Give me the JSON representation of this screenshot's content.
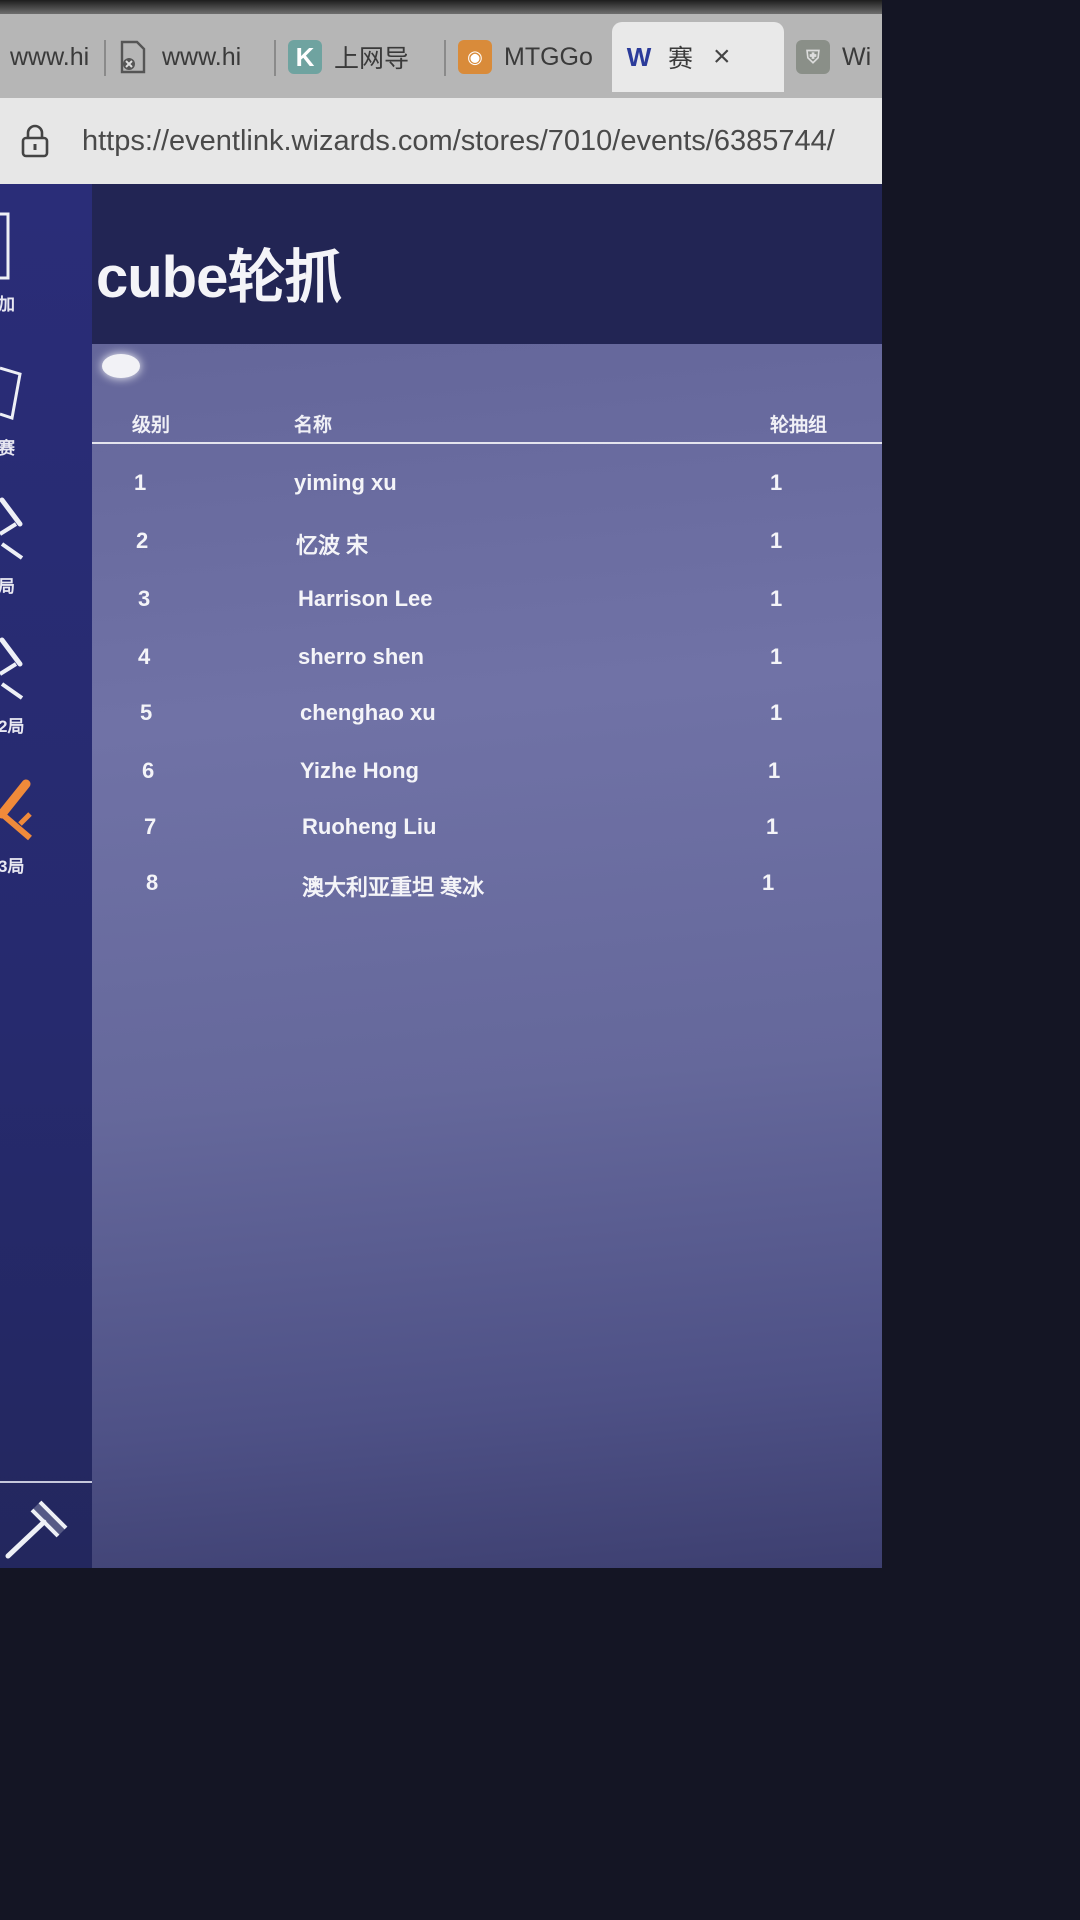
{
  "browser": {
    "tabs": [
      {
        "label": "www.hi",
        "icon": "globe-icon"
      },
      {
        "label": "www.hi",
        "icon": "broken-page-icon"
      },
      {
        "label": "上网导",
        "icon": "k-logo-icon"
      },
      {
        "label": "MTGGo",
        "icon": "mtggo-logo-icon"
      },
      {
        "label": "赛",
        "icon": "wizards-w-icon",
        "close": "×"
      },
      {
        "label": "Wi",
        "icon": "shield-logo-icon"
      }
    ],
    "url": "https://eventlink.wizards.com/stores/7010/events/6385744/"
  },
  "sidebar": {
    "items": [
      {
        "label": "加",
        "icon": "add-player-icon"
      },
      {
        "label": "赛",
        "icon": "cards-icon"
      },
      {
        "label": "局",
        "icon": "swords-icon"
      },
      {
        "label": "2局",
        "icon": "swords-icon"
      },
      {
        "label": "3局",
        "icon": "swords-active-icon"
      }
    ],
    "bottom_icon": "gavel-icon"
  },
  "event": {
    "title": "cube轮抓"
  },
  "table": {
    "headers": {
      "rank": "级别",
      "name": "名称",
      "pod": "轮抽组"
    },
    "rows": [
      {
        "rank": "1",
        "name": "yiming xu",
        "pod": "1"
      },
      {
        "rank": "2",
        "name": "忆波 宋",
        "pod": "1"
      },
      {
        "rank": "3",
        "name": "Harrison Lee",
        "pod": "1"
      },
      {
        "rank": "4",
        "name": "sherro shen",
        "pod": "1"
      },
      {
        "rank": "5",
        "name": "chenghao xu",
        "pod": "1"
      },
      {
        "rank": "6",
        "name": "Yizhe Hong",
        "pod": "1"
      },
      {
        "rank": "7",
        "name": "Ruoheng Liu",
        "pod": "1"
      },
      {
        "rank": "8",
        "name": "澳大利亚重坦 寒冰",
        "pod": "1"
      }
    ]
  },
  "colors": {
    "sidebar": "#2a2d78",
    "header": "#222554",
    "panel": "#6c6ea2",
    "accent_active": "#f08a3a"
  }
}
